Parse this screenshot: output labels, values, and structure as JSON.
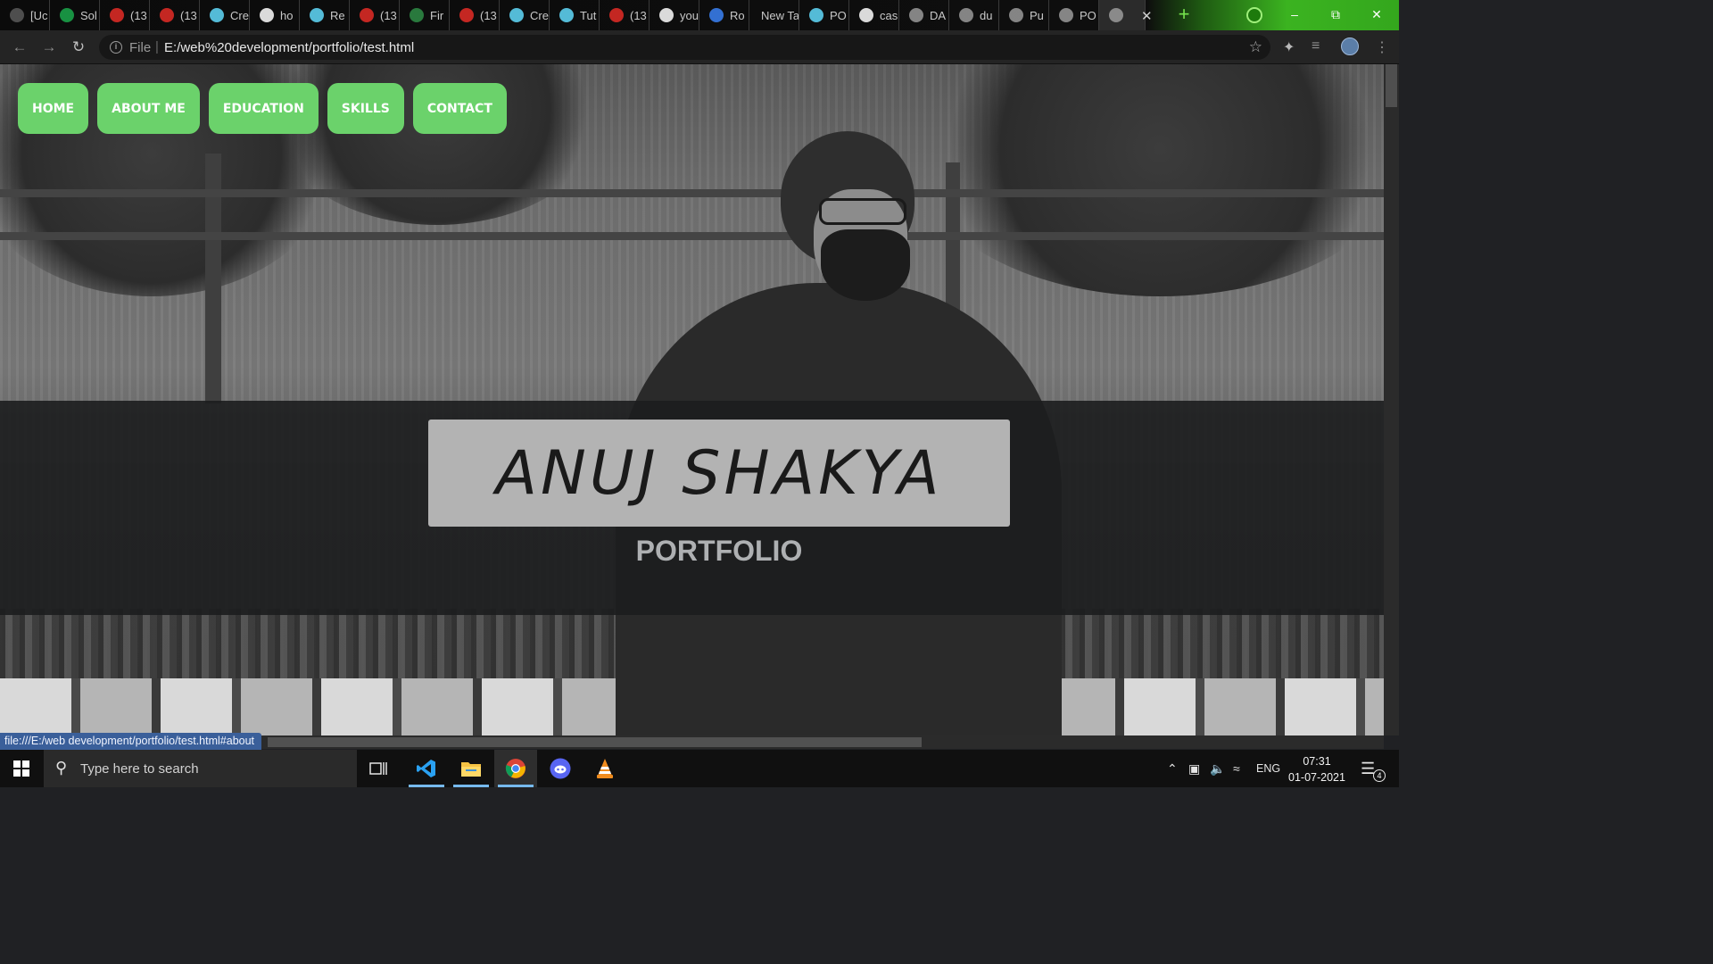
{
  "browser": {
    "tabs": [
      {
        "title": "[Uc",
        "icon": "reddit-icon",
        "color": "#5a5a5a"
      },
      {
        "title": "Sol",
        "icon": "hackerrank-icon",
        "color": "#1ba94c"
      },
      {
        "title": "(13",
        "icon": "youtube-icon",
        "color": "#e52d27"
      },
      {
        "title": "(13",
        "icon": "youtube-icon",
        "color": "#e52d27"
      },
      {
        "title": "Cre",
        "icon": "react-icon",
        "color": "#61dafb"
      },
      {
        "title": "ho",
        "icon": "google-icon",
        "color": "#ffffff"
      },
      {
        "title": "Re",
        "icon": "react-icon",
        "color": "#61dafb"
      },
      {
        "title": "(13",
        "icon": "youtube-icon",
        "color": "#e52d27"
      },
      {
        "title": "Fir",
        "icon": "gfg-icon",
        "color": "#2f8d46"
      },
      {
        "title": "(13",
        "icon": "youtube-icon",
        "color": "#e52d27"
      },
      {
        "title": "Cre",
        "icon": "react-icon",
        "color": "#61dafb"
      },
      {
        "title": "Tut",
        "icon": "react-icon",
        "color": "#61dafb"
      },
      {
        "title": "(13",
        "icon": "youtube-icon",
        "color": "#e52d27"
      },
      {
        "title": "you",
        "icon": "github-icon",
        "color": "#ffffff"
      },
      {
        "title": "Ro",
        "icon": "app-icon",
        "color": "#3b82f6"
      },
      {
        "title": "New Ta",
        "icon": "",
        "color": ""
      },
      {
        "title": "PO",
        "icon": "react-icon",
        "color": "#61dafb"
      },
      {
        "title": "cas",
        "icon": "google-icon",
        "color": "#ffffff"
      },
      {
        "title": "DA",
        "icon": "cc-icon",
        "color": "#9a9a9a"
      },
      {
        "title": "du",
        "icon": "cc-icon",
        "color": "#9a9a9a"
      },
      {
        "title": "Pu",
        "icon": "file-icon",
        "color": "#9a9a9a"
      },
      {
        "title": "PO",
        "icon": "globe-icon",
        "color": "#9a9a9a"
      }
    ],
    "active_tab_index": 22,
    "address": {
      "scheme_label": "File",
      "url": "E:/web%20development/portfolio/test.html"
    }
  },
  "page": {
    "nav": [
      "HOME",
      "ABOUT ME",
      "EDUCATION",
      "SKILLS",
      "CONTACT"
    ],
    "name": "ANUJ SHAKYA",
    "subtitle": "PORTFOLIO",
    "accent_color": "#6bd26b",
    "status_url": "file:///E:/web development/portfolio/test.html#about"
  },
  "taskbar": {
    "search_placeholder": "Type here to search",
    "apps": [
      "task-view-icon",
      "vscode-icon",
      "file-explorer-icon",
      "chrome-icon",
      "discord-icon",
      "vlc-icon"
    ],
    "language": "ENG",
    "time": "07:31",
    "date": "01-07-2021",
    "notification_count": "4"
  }
}
